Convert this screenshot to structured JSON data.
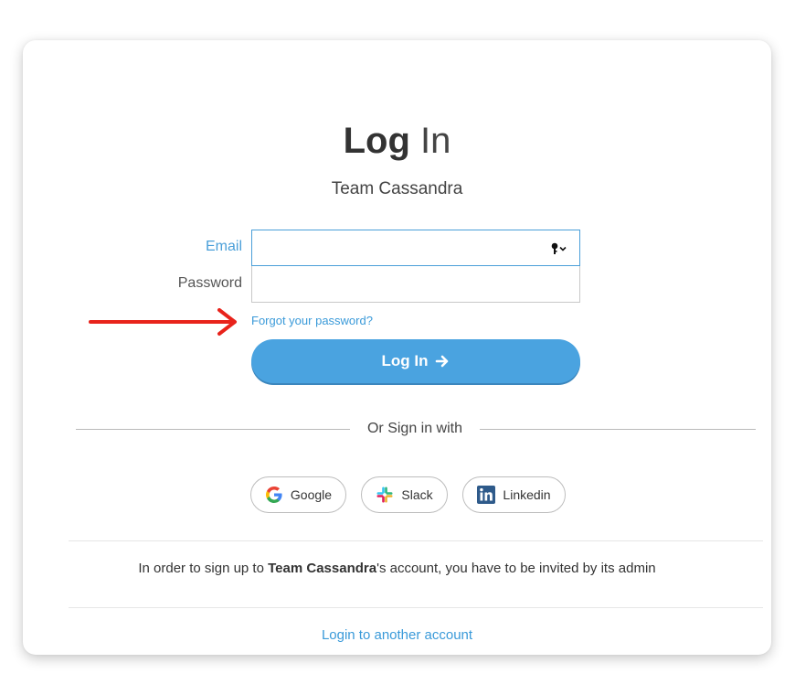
{
  "header": {
    "title_bold": "Log",
    "title_light": "In",
    "team_name": "Team Cassandra"
  },
  "form": {
    "email_label": "Email",
    "email_value": "",
    "password_label": "Password",
    "password_value": "",
    "forgot_link": "Forgot your password?",
    "submit_label": "Log In"
  },
  "divider": {
    "text": "Or Sign in with"
  },
  "sso": [
    {
      "label": "Google",
      "icon": "google-icon"
    },
    {
      "label": "Slack",
      "icon": "slack-icon"
    },
    {
      "label": "Linkedin",
      "icon": "linkedin-icon"
    }
  ],
  "footer": {
    "invite_prefix": "In order to sign up to ",
    "invite_team": "Team Cassandra",
    "invite_suffix": "'s account, you have to be invited by its admin",
    "another_account_link": "Login to another account"
  },
  "annotation": {
    "arrow_icon": "red-arrow-annotation-icon",
    "color": "#e8231b"
  },
  "colors": {
    "accent": "#4aa3e0",
    "link": "#3a9ad9",
    "text": "#333333"
  }
}
